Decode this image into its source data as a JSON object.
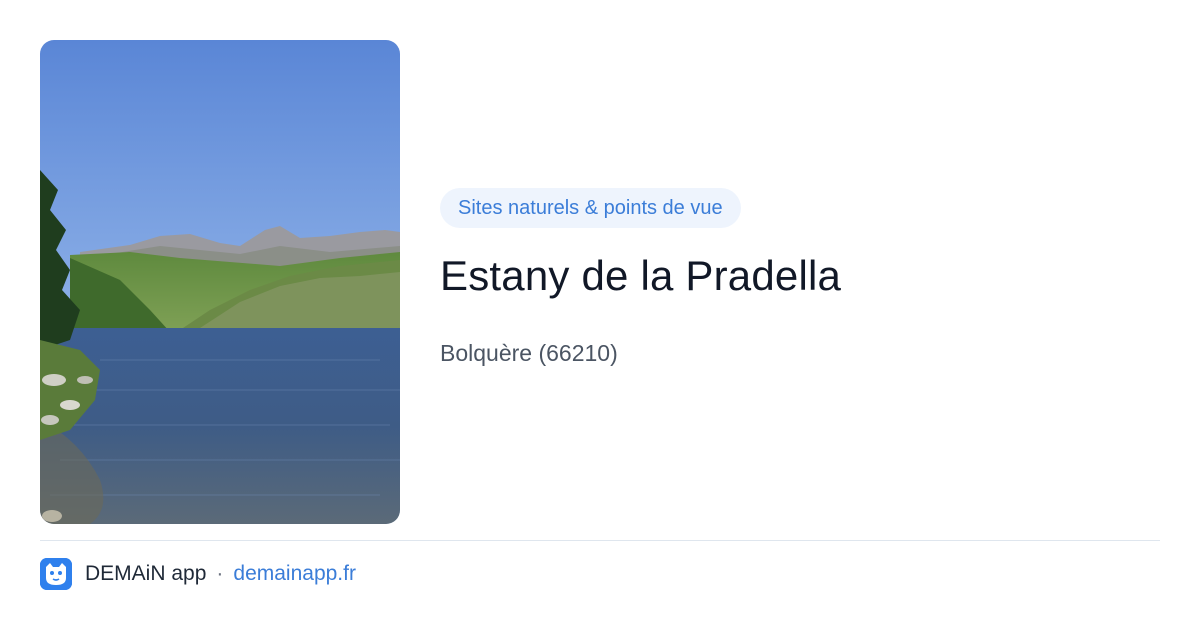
{
  "place": {
    "category": "Sites naturels & points de vue",
    "name": "Estany de la Pradella",
    "location": "Bolquère (66210)"
  },
  "footer": {
    "app_name": "DEMAiN app",
    "separator": "·",
    "site": "demainapp.fr"
  },
  "colors": {
    "accent": "#3b7dd8",
    "badge_bg": "#eef4fd",
    "title": "#111827",
    "subtitle": "#4b5563",
    "logo_bg": "#2f80ed"
  },
  "icons": {
    "logo": "demain-logo-icon"
  }
}
